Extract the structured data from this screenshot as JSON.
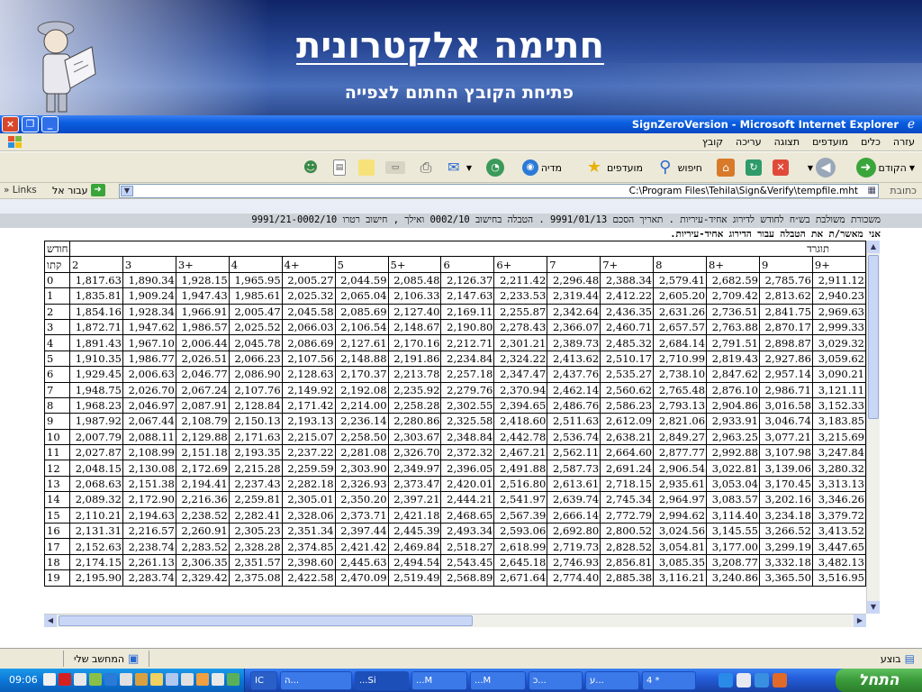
{
  "slide": {
    "title": "חתימה אלקטרונית",
    "subtitle": "פתיחת הקובץ החתום לצפייה"
  },
  "window": {
    "title": "SignZeroVersion - Microsoft Internet Explorer",
    "close": "×",
    "maximize": "❐",
    "minimize": "_"
  },
  "menu": [
    "קובץ",
    "עריכה",
    "תצוגה",
    "מועדפים",
    "כלים",
    "עזרה"
  ],
  "toolbar": {
    "back": "הקודם",
    "search": "חיפוש",
    "favorites": "מועדפים",
    "media": "מדיה"
  },
  "address": {
    "label": "כתובת",
    "url": "C:\\Program Files\\Tehila\\Sign&Verify\\tempfile.mht",
    "go": "עבור אל",
    "links": "Links"
  },
  "document": {
    "caption1": "משכורת משולבת בש״ח לחודש לדירוג אחיד-עיריות . תאריך הסכם 9991/01/13 . הטבלה בחישוב 0002/10 ואילך , חישוב רטרו 9991/21-0002/10",
    "caption2": "אני   מאשר/ת את הטבלה עבור הדירוג   אחיד-עיריות."
  },
  "table": {
    "corner_top": "חודש",
    "corner_bottom": "קתו",
    "grade_label": "תוגרד",
    "columns": [
      "2",
      "3",
      "3+",
      "4",
      "4+",
      "5",
      "5+",
      "6",
      "6+",
      "7",
      "7+",
      "8",
      "8+",
      "9",
      "9+"
    ],
    "rows": [
      {
        "label": "0",
        "values": [
          "1,817.63",
          "1,890.34",
          "1,928.15",
          "1,965.95",
          "2,005.27",
          "2,044.59",
          "2,085.48",
          "2,126.37",
          "2,211.42",
          "2,296.48",
          "2,388.34",
          "2,579.41",
          "2,682.59",
          "2,785.76",
          "2,911.12"
        ]
      },
      {
        "label": "1",
        "values": [
          "1,835.81",
          "1,909.24",
          "1,947.43",
          "1,985.61",
          "2,025.32",
          "2,065.04",
          "2,106.33",
          "2,147.63",
          "2,233.53",
          "2,319.44",
          "2,412.22",
          "2,605.20",
          "2,709.42",
          "2,813.62",
          "2,940.23"
        ]
      },
      {
        "label": "2",
        "values": [
          "1,854.16",
          "1,928.34",
          "1,966.91",
          "2,005.47",
          "2,045.58",
          "2,085.69",
          "2,127.40",
          "2,169.11",
          "2,255.87",
          "2,342.64",
          "2,436.35",
          "2,631.26",
          "2,736.51",
          "2,841.75",
          "2,969.63"
        ]
      },
      {
        "label": "3",
        "values": [
          "1,872.71",
          "1,947.62",
          "1,986.57",
          "2,025.52",
          "2,066.03",
          "2,106.54",
          "2,148.67",
          "2,190.80",
          "2,278.43",
          "2,366.07",
          "2,460.71",
          "2,657.57",
          "2,763.88",
          "2,870.17",
          "2,999.33"
        ]
      },
      {
        "label": "4",
        "values": [
          "1,891.43",
          "1,967.10",
          "2,006.44",
          "2,045.78",
          "2,086.69",
          "2,127.61",
          "2,170.16",
          "2,212.71",
          "2,301.21",
          "2,389.73",
          "2,485.32",
          "2,684.14",
          "2,791.51",
          "2,898.87",
          "3,029.32"
        ]
      },
      {
        "label": "5",
        "values": [
          "1,910.35",
          "1,986.77",
          "2,026.51",
          "2,066.23",
          "2,107.56",
          "2,148.88",
          "2,191.86",
          "2,234.84",
          "2,324.22",
          "2,413.62",
          "2,510.17",
          "2,710.99",
          "2,819.43",
          "2,927.86",
          "3,059.62"
        ]
      },
      {
        "label": "6",
        "values": [
          "1,929.45",
          "2,006.63",
          "2,046.77",
          "2,086.90",
          "2,128.63",
          "2,170.37",
          "2,213.78",
          "2,257.18",
          "2,347.47",
          "2,437.76",
          "2,535.27",
          "2,738.10",
          "2,847.62",
          "2,957.14",
          "3,090.21"
        ]
      },
      {
        "label": "7",
        "values": [
          "1,948.75",
          "2,026.70",
          "2,067.24",
          "2,107.76",
          "2,149.92",
          "2,192.08",
          "2,235.92",
          "2,279.76",
          "2,370.94",
          "2,462.14",
          "2,560.62",
          "2,765.48",
          "2,876.10",
          "2,986.71",
          "3,121.11"
        ]
      },
      {
        "label": "8",
        "values": [
          "1,968.23",
          "2,046.97",
          "2,087.91",
          "2,128.84",
          "2,171.42",
          "2,214.00",
          "2,258.28",
          "2,302.55",
          "2,394.65",
          "2,486.76",
          "2,586.23",
          "2,793.13",
          "2,904.86",
          "3,016.58",
          "3,152.33"
        ]
      },
      {
        "label": "9",
        "values": [
          "1,987.92",
          "2,067.44",
          "2,108.79",
          "2,150.13",
          "2,193.13",
          "2,236.14",
          "2,280.86",
          "2,325.58",
          "2,418.60",
          "2,511.63",
          "2,612.09",
          "2,821.06",
          "2,933.91",
          "3,046.74",
          "3,183.85"
        ]
      },
      {
        "label": "10",
        "values": [
          "2,007.79",
          "2,088.11",
          "2,129.88",
          "2,171.63",
          "2,215.07",
          "2,258.50",
          "2,303.67",
          "2,348.84",
          "2,442.78",
          "2,536.74",
          "2,638.21",
          "2,849.27",
          "2,963.25",
          "3,077.21",
          "3,215.69"
        ]
      },
      {
        "label": "11",
        "values": [
          "2,027.87",
          "2,108.99",
          "2,151.18",
          "2,193.35",
          "2,237.22",
          "2,281.08",
          "2,326.70",
          "2,372.32",
          "2,467.21",
          "2,562.11",
          "2,664.60",
          "2,877.77",
          "2,992.88",
          "3,107.98",
          "3,247.84"
        ]
      },
      {
        "label": "12",
        "values": [
          "2,048.15",
          "2,130.08",
          "2,172.69",
          "2,215.28",
          "2,259.59",
          "2,303.90",
          "2,349.97",
          "2,396.05",
          "2,491.88",
          "2,587.73",
          "2,691.24",
          "2,906.54",
          "3,022.81",
          "3,139.06",
          "3,280.32"
        ]
      },
      {
        "label": "13",
        "values": [
          "2,068.63",
          "2,151.38",
          "2,194.41",
          "2,237.43",
          "2,282.18",
          "2,326.93",
          "2,373.47",
          "2,420.01",
          "2,516.80",
          "2,613.61",
          "2,718.15",
          "2,935.61",
          "3,053.04",
          "3,170.45",
          "3,313.13"
        ]
      },
      {
        "label": "14",
        "values": [
          "2,089.32",
          "2,172.90",
          "2,216.36",
          "2,259.81",
          "2,305.01",
          "2,350.20",
          "2,397.21",
          "2,444.21",
          "2,541.97",
          "2,639.74",
          "2,745.34",
          "2,964.97",
          "3,083.57",
          "3,202.16",
          "3,346.26"
        ]
      },
      {
        "label": "15",
        "values": [
          "2,110.21",
          "2,194.63",
          "2,238.52",
          "2,282.41",
          "2,328.06",
          "2,373.71",
          "2,421.18",
          "2,468.65",
          "2,567.39",
          "2,666.14",
          "2,772.79",
          "2,994.62",
          "3,114.40",
          "3,234.18",
          "3,379.72"
        ]
      },
      {
        "label": "16",
        "values": [
          "2,131.31",
          "2,216.57",
          "2,260.91",
          "2,305.23",
          "2,351.34",
          "2,397.44",
          "2,445.39",
          "2,493.34",
          "2,593.06",
          "2,692.80",
          "2,800.52",
          "3,024.56",
          "3,145.55",
          "3,266.52",
          "3,413.52"
        ]
      },
      {
        "label": "17",
        "values": [
          "2,152.63",
          "2,238.74",
          "2,283.52",
          "2,328.28",
          "2,374.85",
          "2,421.42",
          "2,469.84",
          "2,518.27",
          "2,618.99",
          "2,719.73",
          "2,828.52",
          "3,054.81",
          "3,177.00",
          "3,299.19",
          "3,447.65"
        ]
      },
      {
        "label": "18",
        "values": [
          "2,174.15",
          "2,261.13",
          "2,306.35",
          "2,351.57",
          "2,398.60",
          "2,445.63",
          "2,494.54",
          "2,543.45",
          "2,645.18",
          "2,746.93",
          "2,856.81",
          "3,085.35",
          "3,208.77",
          "3,332.18",
          "3,482.13"
        ]
      },
      {
        "label": "19",
        "values": [
          "2,195.90",
          "2,283.74",
          "2,329.42",
          "2,375.08",
          "2,422.58",
          "2,470.09",
          "2,519.49",
          "2,568.89",
          "2,671.64",
          "2,774.40",
          "2,885.38",
          "3,116.21",
          "3,240.86",
          "3,365.50",
          "3,516.95"
        ]
      }
    ]
  },
  "statusbar": {
    "left": "המחשב שלי",
    "right": "בוצע"
  },
  "taskbar": {
    "start": "התחל",
    "clock": "09:06",
    "tasks": [
      "ה...",
      "...Si",
      "...M",
      "...M",
      "כ...",
      "ע...",
      "4 *"
    ],
    "lang": "IC"
  },
  "colors": {
    "xp_blue": "#0a5ee0",
    "start_green": "#3a9a3a",
    "chrome": "#ece9d8"
  }
}
